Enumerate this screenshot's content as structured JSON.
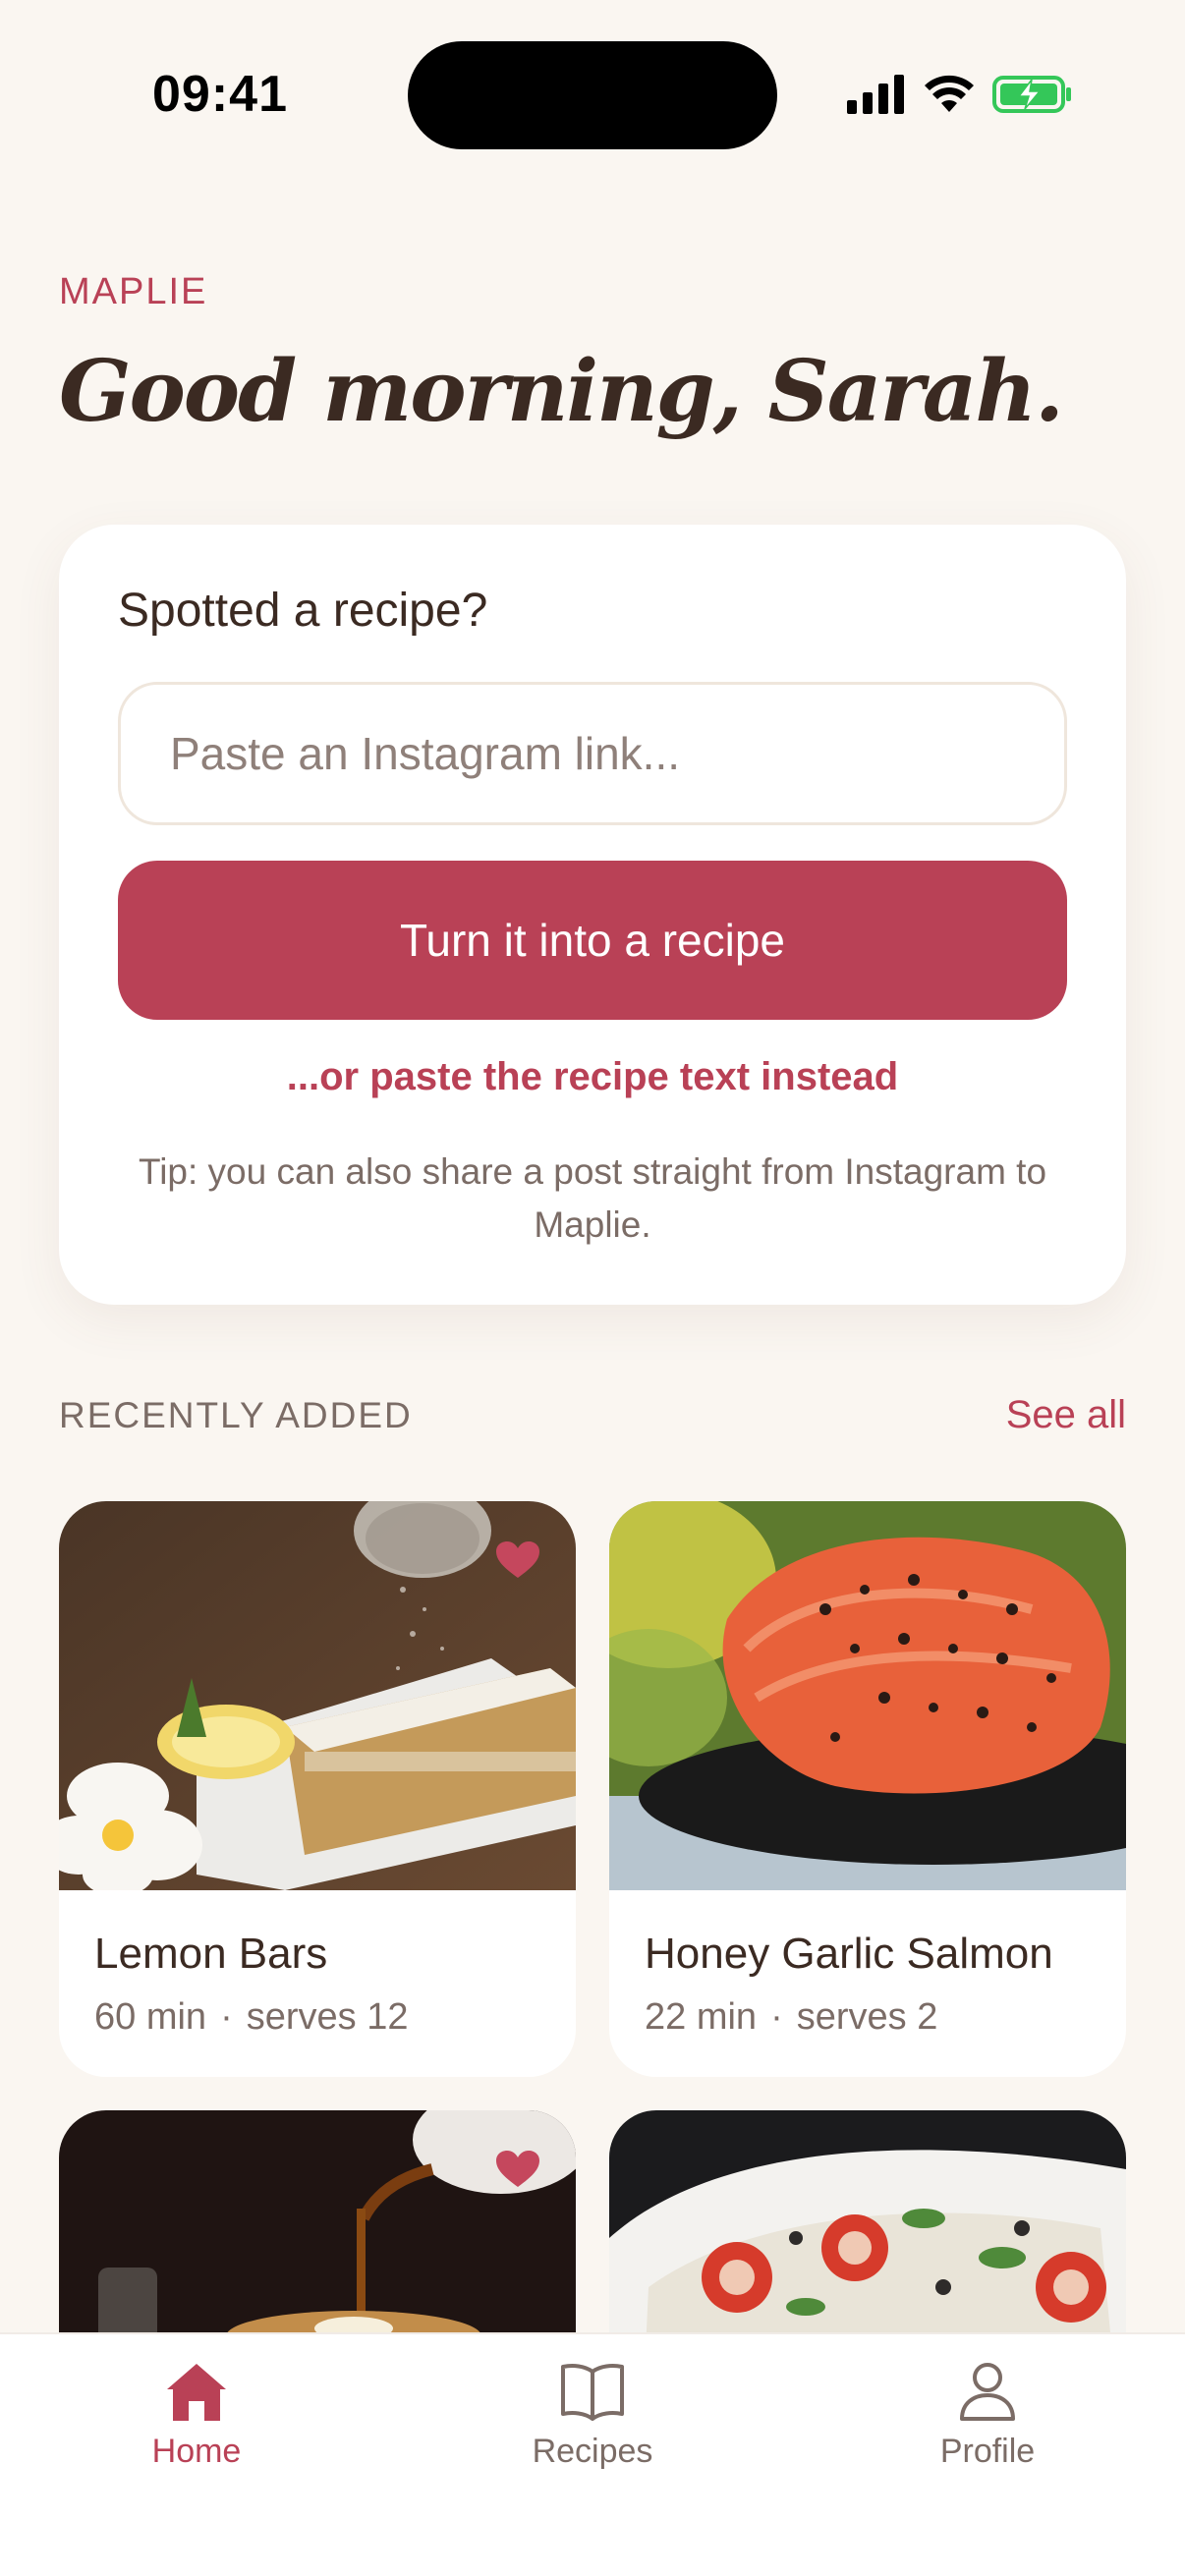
{
  "status_bar": {
    "time": "09:41"
  },
  "header": {
    "brand": "MAPLIE",
    "greeting": "Good morning, Sarah."
  },
  "import_card": {
    "title": "Spotted a recipe?",
    "input_placeholder": "Paste an Instagram link...",
    "input_value": "",
    "primary_button": "Turn it into a recipe",
    "alt_link": "...or paste the recipe text instead",
    "tip": "Tip: you can also share a post straight from Instagram to Maplie."
  },
  "recently_added": {
    "label": "RECENTLY ADDED",
    "see_all": "See all",
    "recipes": [
      {
        "name": "Lemon Bars",
        "time": "60 min",
        "serves": "serves 12",
        "favorited": true
      },
      {
        "name": "Honey Garlic Salmon",
        "time": "22 min",
        "serves": "serves 2",
        "favorited": false
      },
      {
        "name": "",
        "time": "",
        "serves": "",
        "favorited": true
      },
      {
        "name": "",
        "time": "",
        "serves": "",
        "favorited": false
      }
    ],
    "meta_separator": "·"
  },
  "tab_bar": {
    "tabs": [
      {
        "label": "Home",
        "icon": "home-icon",
        "active": true
      },
      {
        "label": "Recipes",
        "icon": "book-icon",
        "active": false
      },
      {
        "label": "Profile",
        "icon": "person-icon",
        "active": false
      }
    ]
  },
  "colors": {
    "background": "#faf6f1",
    "accent": "#b94156",
    "text": "#3b2a22",
    "muted": "#7b6c66",
    "battery": "#34c759"
  }
}
